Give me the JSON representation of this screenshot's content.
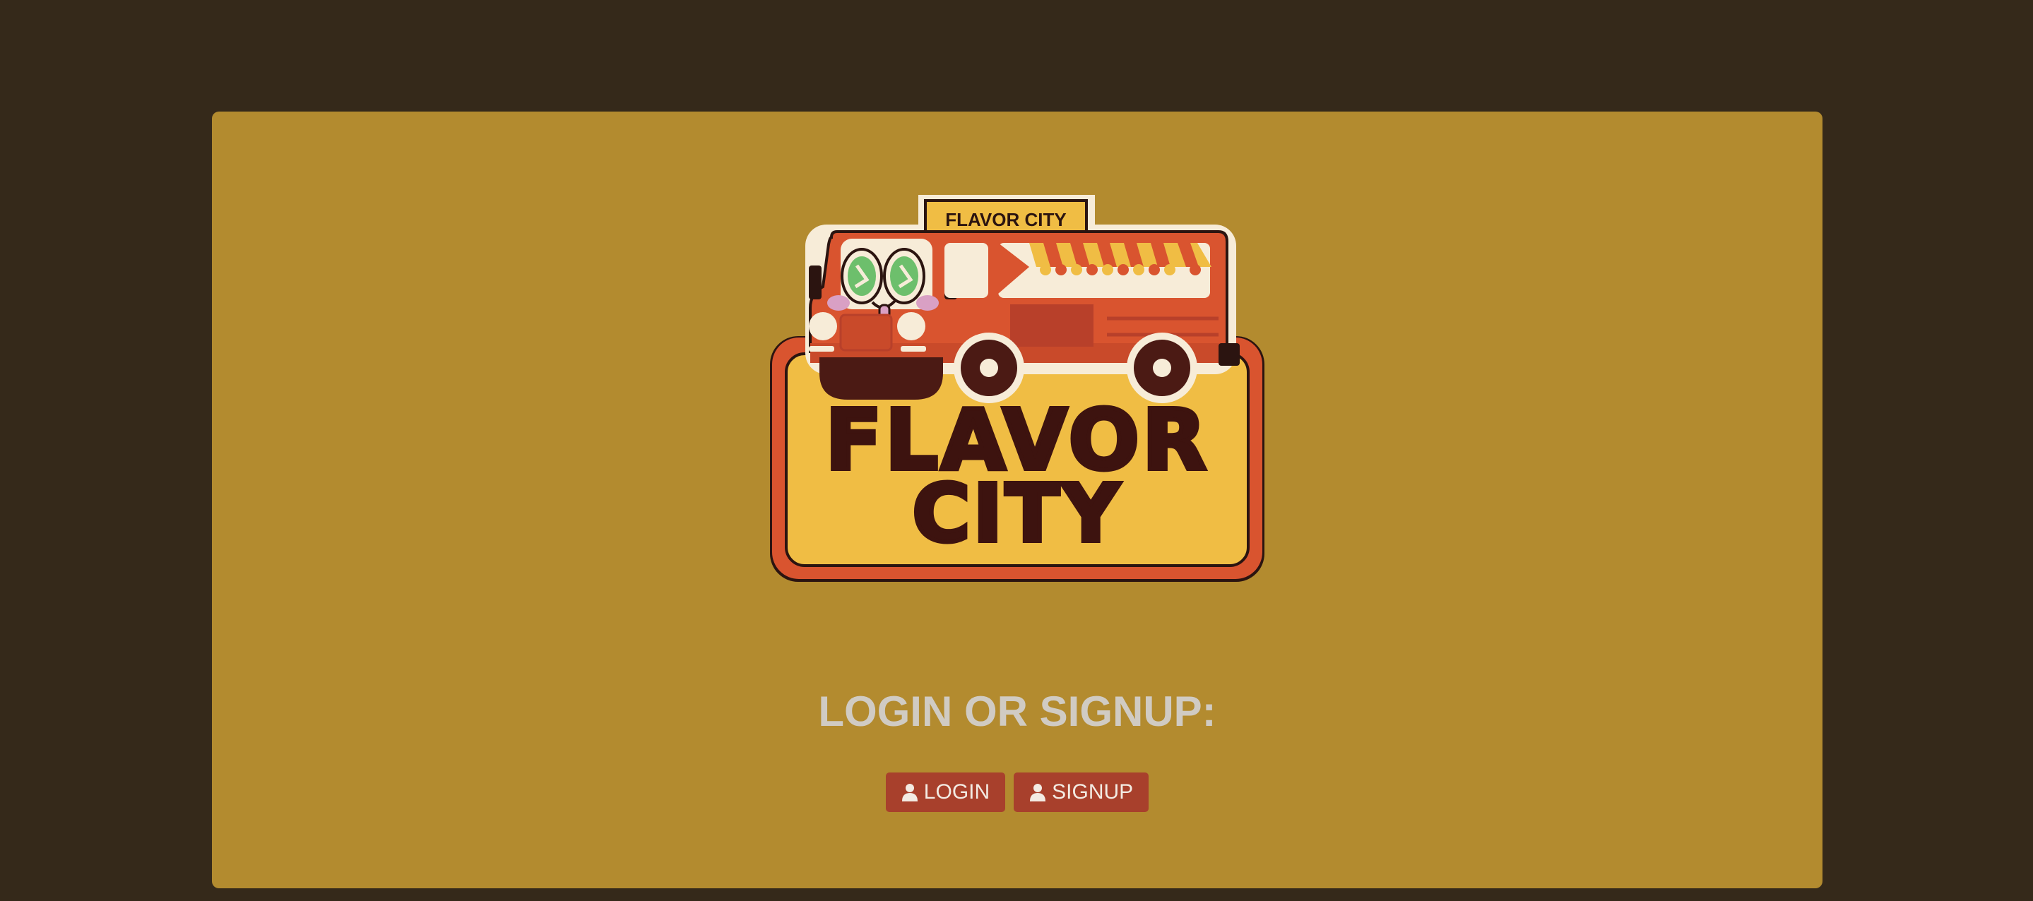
{
  "brand": {
    "logo_sign_text": "FLAVOR CITY",
    "logo_line1": "FLAVOR",
    "logo_line2": "CITY"
  },
  "auth": {
    "heading": "LOGIN OR SIGNUP:",
    "login_label": "LOGIN",
    "signup_label": "SIGNUP",
    "login_icon": "user-icon",
    "signup_icon": "user-icon"
  },
  "colors": {
    "page_bg": "#35291a",
    "card_bg": "#b38b2f",
    "button_bg": "#a8402c",
    "heading_text": "#d0cbc3"
  }
}
